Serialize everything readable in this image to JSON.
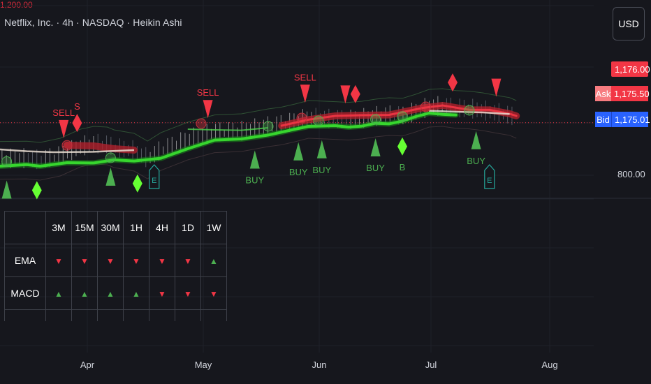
{
  "header": {
    "title": "Netflix, Inc. · 4h · NASDAQ · Heikin Ashi"
  },
  "currency_button": "USD",
  "price": {
    "current": "1,176.00",
    "partial_label": "1,200.00",
    "ask_label": "Ask",
    "ask": "1,175.50",
    "bid_label": "Bid",
    "bid": "1,175.01"
  },
  "colors": {
    "background": "#16171d",
    "bull": "#4caf50",
    "bull_bright": "#66ff33",
    "bear": "#f23645",
    "ema_white": "#e8dcd0",
    "ask_bg": "#f23645",
    "bid_bg": "#2962ff"
  },
  "chart_data": {
    "type": "line",
    "x_ticks": [
      "Apr",
      "May",
      "Jun",
      "Jul",
      "Aug"
    ],
    "y_ticks": [
      "800.00"
    ],
    "price_path": [
      [
        0,
        902
      ],
      [
        4,
        904
      ],
      [
        6,
        895
      ],
      [
        9,
        925
      ],
      [
        12,
        990
      ],
      [
        14,
        1010
      ],
      [
        16,
        1005
      ],
      [
        17,
        985
      ],
      [
        20,
        960
      ],
      [
        22,
        905
      ],
      [
        24,
        965
      ],
      [
        28,
        1040
      ],
      [
        32,
        1092
      ],
      [
        36,
        1100
      ],
      [
        40,
        1135
      ],
      [
        42,
        1148
      ],
      [
        44,
        1170
      ],
      [
        46,
        1195
      ],
      [
        50,
        1187
      ],
      [
        52,
        1182
      ],
      [
        54,
        1190
      ],
      [
        56,
        1205
      ],
      [
        58,
        1215
      ],
      [
        60,
        1211
      ],
      [
        62,
        1240
      ],
      [
        64,
        1275
      ],
      [
        66,
        1280
      ],
      [
        68,
        1266
      ],
      [
        70,
        1262
      ],
      [
        72,
        1250
      ],
      [
        74,
        1232
      ],
      [
        76,
        1216
      ],
      [
        77,
        1195
      ]
    ],
    "trend_green": [
      [
        0,
        895
      ],
      [
        4,
        906
      ],
      [
        6,
        895
      ],
      [
        10,
        920
      ],
      [
        14,
        918
      ],
      [
        17,
        940
      ],
      [
        20,
        932
      ],
      [
        24,
        952
      ],
      [
        28,
        1020
      ],
      [
        32,
        1082
      ],
      [
        36,
        1090
      ],
      [
        40,
        1118
      ],
      [
        44,
        1160
      ],
      [
        46,
        1180
      ],
      [
        50,
        1185
      ],
      [
        52,
        1175
      ],
      [
        54,
        1182
      ],
      [
        56,
        1202
      ],
      [
        58,
        1198
      ],
      [
        60,
        1218
      ],
      [
        62,
        1250
      ],
      [
        64,
        1275
      ],
      [
        66,
        1266
      ],
      [
        68,
        1262
      ]
    ],
    "trend_red": [
      [
        10,
        1015
      ],
      [
        14,
        1010
      ],
      [
        17,
        990
      ],
      [
        20,
        980
      ],
      [
        42,
        1155
      ],
      [
        46,
        1198
      ],
      [
        50,
        1225
      ],
      [
        54,
        1230
      ],
      [
        58,
        1232
      ],
      [
        63,
        1282
      ],
      [
        66,
        1300
      ],
      [
        70,
        1268
      ],
      [
        73,
        1268
      ],
      [
        76,
        1240
      ],
      [
        77,
        1225
      ]
    ],
    "signals": [
      {
        "type": "buy",
        "shape": "triangle",
        "x": 1,
        "text": ""
      },
      {
        "type": "buy",
        "shape": "diamond",
        "x": 5.5,
        "text": ""
      },
      {
        "type": "sell",
        "shape": "triangle",
        "x": 9.5,
        "text": "SELL"
      },
      {
        "type": "sell",
        "shape": "diamond",
        "x": 11.5,
        "text": "S"
      },
      {
        "type": "buy",
        "shape": "triangle",
        "x": 16.5,
        "text": ""
      },
      {
        "type": "buy",
        "shape": "diamond",
        "x": 20.5,
        "text": ""
      },
      {
        "type": "sell",
        "shape": "triangle",
        "x": 31,
        "text": "SELL"
      },
      {
        "type": "buy",
        "shape": "triangle",
        "x": 38,
        "text": "BUY"
      },
      {
        "type": "buy",
        "shape": "triangle",
        "x": 44.5,
        "text": "BUY"
      },
      {
        "type": "buy",
        "shape": "triangle",
        "x": 48,
        "text": "BUY"
      },
      {
        "type": "sell",
        "shape": "triangle",
        "x": 45.5,
        "text": "SELL"
      },
      {
        "type": "sell",
        "shape": "triangle",
        "x": 51.5,
        "text": ""
      },
      {
        "type": "sell",
        "shape": "diamond",
        "x": 53,
        "text": ""
      },
      {
        "type": "buy",
        "shape": "triangle",
        "x": 56,
        "text": "BUY"
      },
      {
        "type": "buy",
        "shape": "diamond",
        "x": 60,
        "text": "B"
      },
      {
        "type": "sell",
        "shape": "diamond",
        "x": 67.5,
        "text": ""
      },
      {
        "type": "buy",
        "shape": "triangle",
        "x": 71,
        "text": "BUY"
      },
      {
        "type": "sell",
        "shape": "triangle",
        "x": 74,
        "text": ""
      }
    ],
    "earnings_markers": [
      {
        "x": 23,
        "label": "E"
      },
      {
        "x": 73,
        "label": "E"
      }
    ]
  },
  "mtf_table": {
    "headers": [
      "",
      "3M",
      "15M",
      "30M",
      "1H",
      "4H",
      "1D",
      "1W"
    ],
    "rows": [
      {
        "label": "EMA",
        "signals": [
          "down",
          "down",
          "down",
          "down",
          "down",
          "down",
          "up"
        ]
      },
      {
        "label": "MACD",
        "signals": [
          "up",
          "up",
          "up",
          "up",
          "down",
          "down",
          "down"
        ]
      }
    ]
  }
}
